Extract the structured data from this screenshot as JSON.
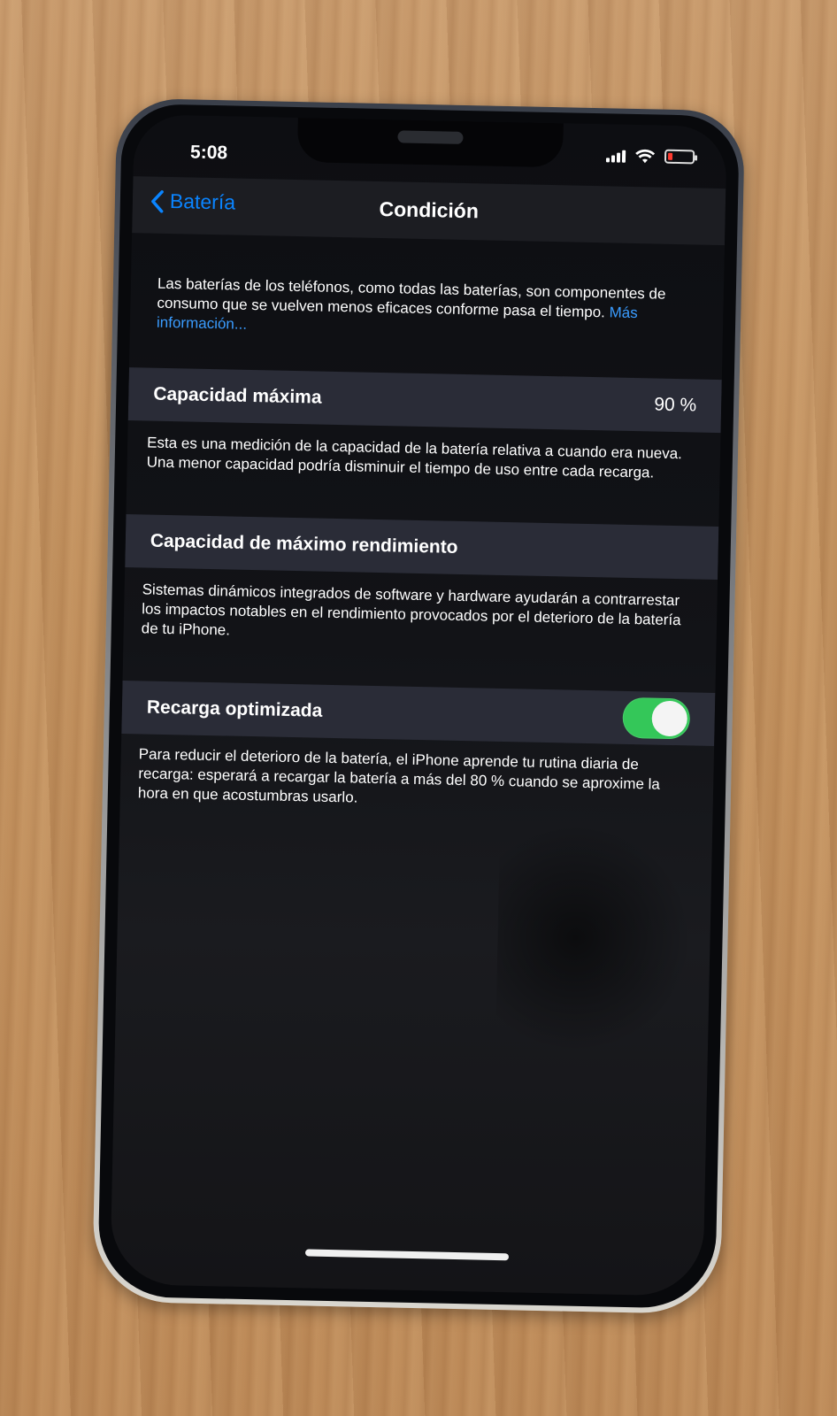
{
  "status": {
    "time": "5:08"
  },
  "nav": {
    "back_label": "Batería",
    "title": "Condición"
  },
  "intro": {
    "text": "Las baterías de los teléfonos, como todas las baterías, son componentes de consumo que se vuelven menos eficaces conforme pasa el tiempo.",
    "link": "Más información..."
  },
  "max_capacity": {
    "label": "Capacidad máxima",
    "value": "90 %",
    "description": "Esta es una medición de la capacidad de la batería relativa a cuando era nueva. Una menor capacidad podría disminuir el tiempo de uso entre cada recarga."
  },
  "peak_performance": {
    "label": "Capacidad de máximo rendimiento",
    "description": "Sistemas dinámicos integrados de software y hardware ayudarán a contrarrestar los impactos notables en el rendimiento provocados por el deterioro de la batería de tu iPhone."
  },
  "optimized_charging": {
    "label": "Recarga optimizada",
    "enabled": true,
    "description": "Para reducir el deterioro de la batería, el iPhone aprende tu rutina diaria de recarga: esperará a recargar la batería a más del 80 % cuando se aproxime la hora en que acostumbras usarlo."
  },
  "colors": {
    "accent": "#0a84ff",
    "toggle_on": "#34c759",
    "battery_low": "#ff3b30"
  },
  "icons": {
    "back": "chevron-left-icon",
    "signal": "cellular-signal-icon",
    "wifi": "wifi-icon",
    "battery": "battery-icon"
  }
}
